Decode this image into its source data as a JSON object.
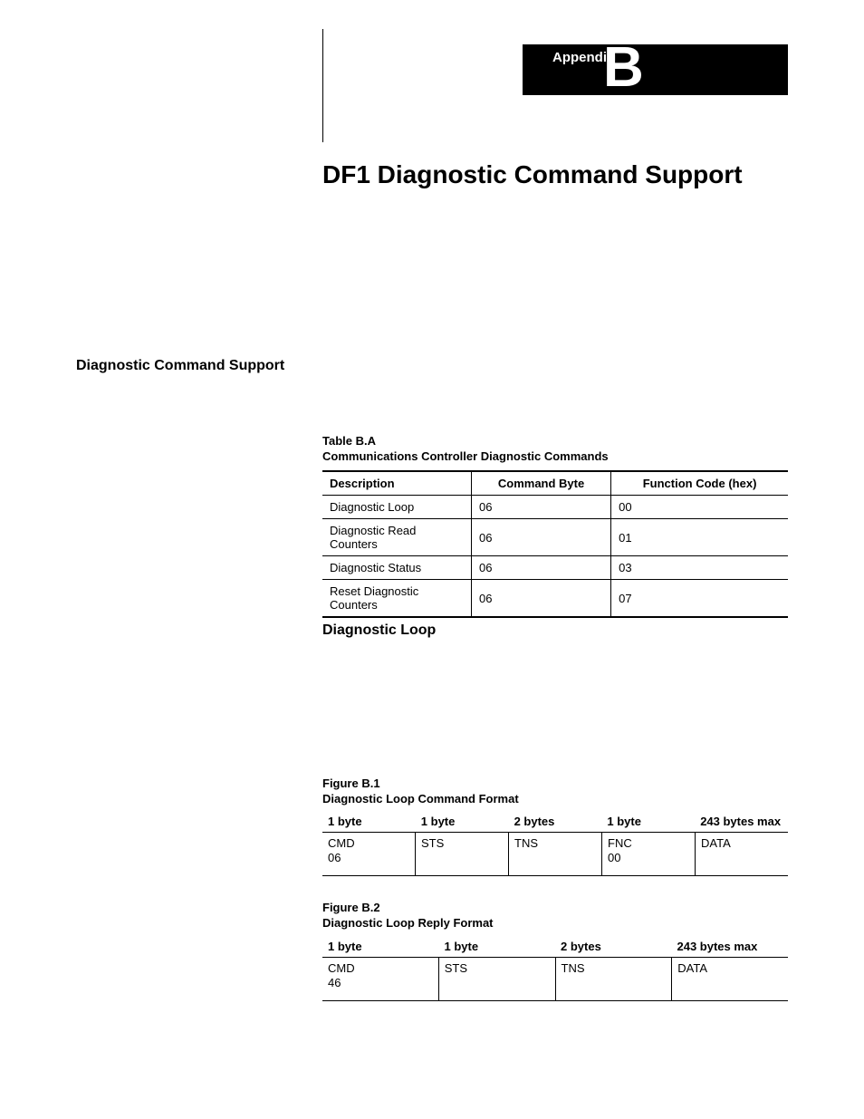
{
  "banner": {
    "label": "Appendix",
    "letter": "B"
  },
  "title": "DF1 Diagnostic Command Support",
  "section_heading": "Diagnostic Command Support",
  "tableA": {
    "caption_line1": "Table B.A",
    "caption_line2": "Communications Controller Diagnostic Commands",
    "headers": [
      "Description",
      "Command Byte",
      "Function Code (hex)"
    ],
    "rows": [
      [
        "Diagnostic Loop",
        "06",
        "00"
      ],
      [
        "Diagnostic Read Counters",
        "06",
        "01"
      ],
      [
        "Diagnostic Status",
        "06",
        "03"
      ],
      [
        "Reset Diagnostic Counters",
        "06",
        "07"
      ]
    ]
  },
  "subheading": "Diagnostic Loop",
  "figure1": {
    "caption_line1": "Figure B.1",
    "caption_line2": "Diagnostic Loop Command Format",
    "headers": [
      "1 byte",
      "1 byte",
      "2 bytes",
      "1 byte",
      "243 bytes max"
    ],
    "cells": [
      "CMD\n06",
      "STS",
      "TNS",
      "FNC\n00",
      "DATA"
    ]
  },
  "figure2": {
    "caption_line1": "Figure B.2",
    "caption_line2": "Diagnostic Loop Reply Format",
    "headers": [
      "1 byte",
      "1 byte",
      "2 bytes",
      "243 bytes max"
    ],
    "cells": [
      "CMD\n46",
      "STS",
      "TNS",
      "DATA"
    ]
  }
}
